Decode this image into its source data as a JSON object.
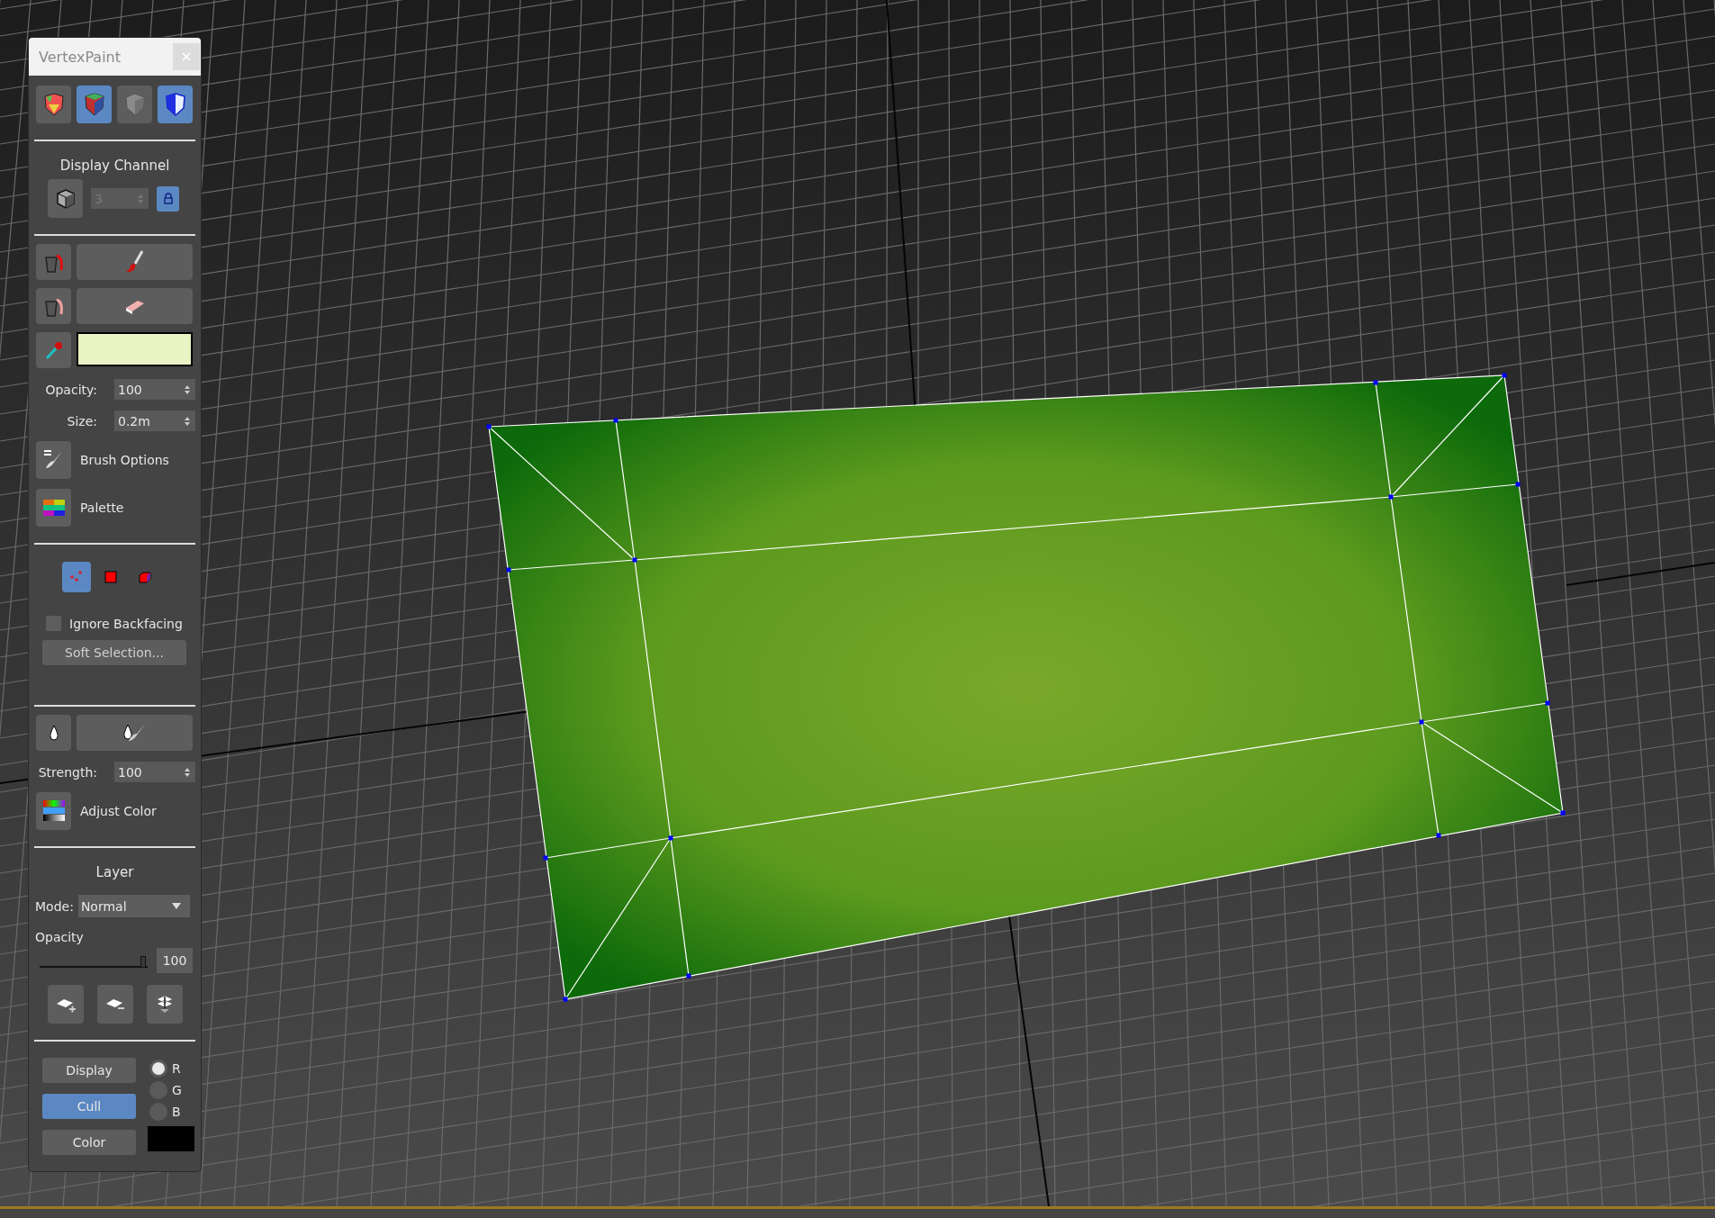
{
  "window": {
    "title": "VertexPaint"
  },
  "display_modes": [
    {
      "kind": "shaded",
      "selected": false
    },
    {
      "kind": "unshaded",
      "selected": true
    },
    {
      "kind": "disable",
      "selected": false
    },
    {
      "kind": "backface",
      "selected": true
    }
  ],
  "display_channel": {
    "label": "Display Channel",
    "value": "3",
    "disabled": true,
    "lock_on": true
  },
  "paint": {
    "color": "#eaf3c4",
    "opacity_label": "Opacity:",
    "opacity": "100",
    "size_label": "Size:",
    "size": "0.2m"
  },
  "brush_buttons": [
    {
      "kind": "brush",
      "label": "Brush Options"
    },
    {
      "kind": "palette",
      "label": "Palette"
    }
  ],
  "selection_modes": [
    {
      "kind": "vertex",
      "selected": true
    },
    {
      "kind": "face",
      "selected": false
    },
    {
      "kind": "element",
      "selected": false
    }
  ],
  "ignore_backfacing": {
    "label": "Ignore Backfacing",
    "checked": false
  },
  "soft_selection": "Soft Selection...",
  "blur": {
    "strength_label": "Strength:",
    "strength": "100",
    "adjust_label": "Adjust Color"
  },
  "layer": {
    "title": "Layer",
    "mode_label": "Mode:",
    "mode": "Normal",
    "opacity_label": "Opacity",
    "level": 1,
    "opacity": "100"
  },
  "view_buttons": [
    {
      "label": "Display",
      "selected": false
    },
    {
      "label": "Cull",
      "selected": true
    },
    {
      "label": "Color",
      "selected": false
    }
  ],
  "display_swatch": {
    "color": "#000000"
  },
  "channels": [
    {
      "label": "R",
      "selected": true
    },
    {
      "label": "G",
      "selected": false
    },
    {
      "label": "B",
      "selected": false
    }
  ]
}
